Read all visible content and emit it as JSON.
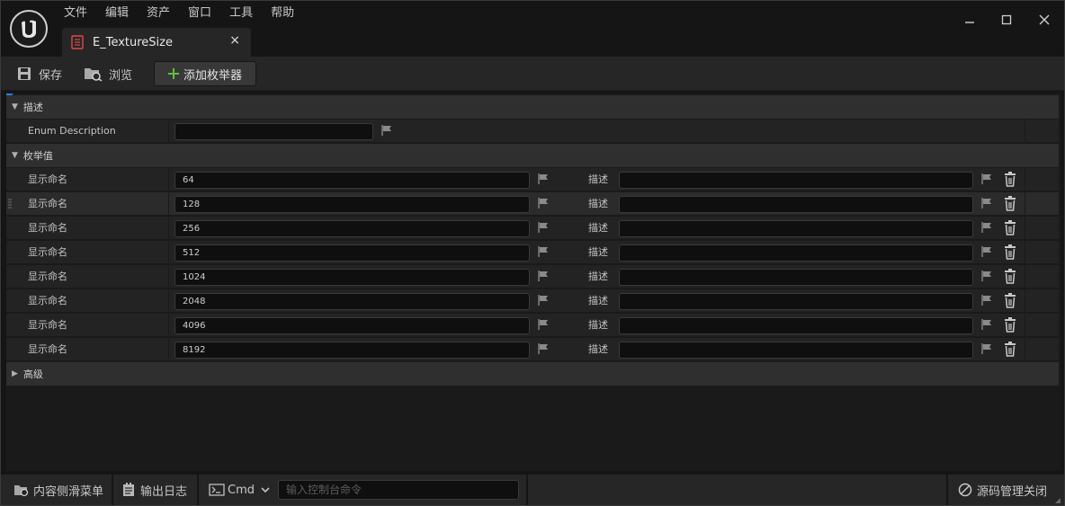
{
  "menu": [
    "文件",
    "编辑",
    "资产",
    "窗口",
    "工具",
    "帮助"
  ],
  "tab": {
    "title": "E_TextureSize",
    "close": "×"
  },
  "toolbar": {
    "save": "保存",
    "browse": "浏览",
    "add_enumerator": "添加枚举器"
  },
  "sections": {
    "description": "描述",
    "enumerators": "枚举值",
    "advanced": "高级"
  },
  "enum_description": {
    "label": "Enum Description",
    "value": ""
  },
  "enumerators": [
    {
      "label": "显示命名",
      "value": "64",
      "desc_label": "描述",
      "desc_value": ""
    },
    {
      "label": "显示命名",
      "value": "128",
      "desc_label": "描述",
      "desc_value": ""
    },
    {
      "label": "显示命名",
      "value": "256",
      "desc_label": "描述",
      "desc_value": ""
    },
    {
      "label": "显示命名",
      "value": "512",
      "desc_label": "描述",
      "desc_value": ""
    },
    {
      "label": "显示命名",
      "value": "1024",
      "desc_label": "描述",
      "desc_value": ""
    },
    {
      "label": "显示命名",
      "value": "2048",
      "desc_label": "描述",
      "desc_value": ""
    },
    {
      "label": "显示命名",
      "value": "4096",
      "desc_label": "描述",
      "desc_value": ""
    },
    {
      "label": "显示命名",
      "value": "8192",
      "desc_label": "描述",
      "desc_value": ""
    }
  ],
  "statusbar": {
    "content_drawer": "内容侧滑菜单",
    "output_log": "输出日志",
    "cmd": "Cmd",
    "console_placeholder": "输入控制台命令",
    "source_control": "源码管理关闭"
  },
  "colors": {
    "accent_green": "#5fbf3a",
    "accent_blue": "#2a7fe0",
    "tab_icon_red": "#e04a4a"
  }
}
